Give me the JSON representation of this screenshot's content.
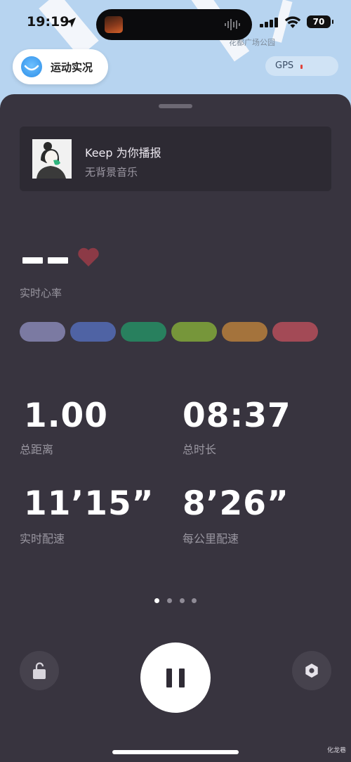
{
  "status_bar": {
    "time": "19:19",
    "battery": "70"
  },
  "map": {
    "place_label": "花都广场公园"
  },
  "sport_live": {
    "label": "运动实况"
  },
  "gps": {
    "label": "GPS"
  },
  "music": {
    "title": "Keep 为你播报",
    "subtitle": "无背景音乐"
  },
  "heart_rate": {
    "label": "实时心率",
    "zone_colors": [
      "#7b7aa2",
      "#4f63a4",
      "#28805e",
      "#76963a",
      "#a4733c",
      "#a34a56"
    ]
  },
  "metrics": [
    {
      "value": "1.00",
      "label": "总距离"
    },
    {
      "value": "08:37",
      "label": "总时长"
    },
    {
      "value": "11’15”",
      "label": "实时配速"
    },
    {
      "value": "8’26”",
      "label": "每公里配速"
    }
  ],
  "pager": {
    "total": 4,
    "active": 1
  },
  "watermark": "化龙巷"
}
